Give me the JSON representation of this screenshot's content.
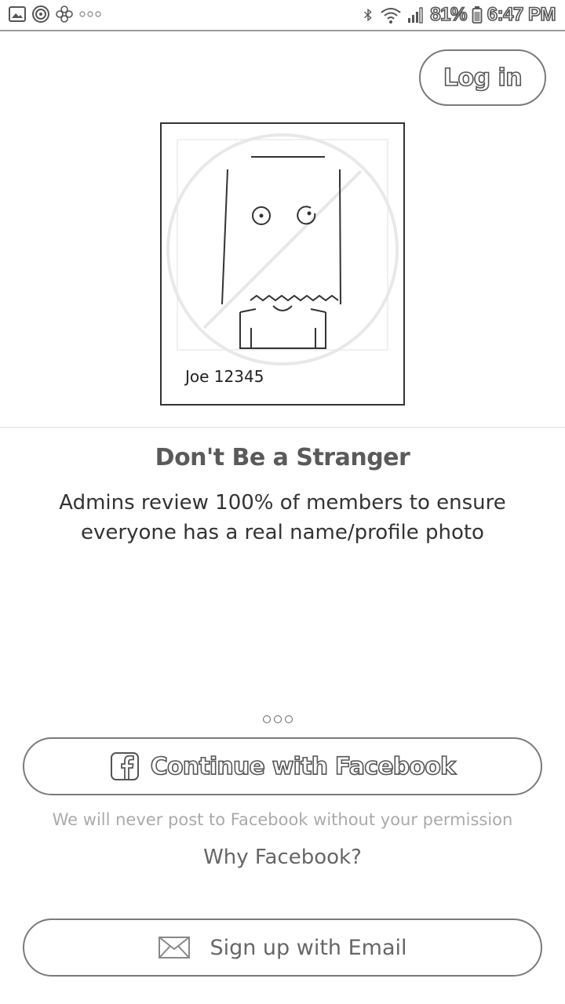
{
  "status_bar": {
    "battery": "81%",
    "time": "6:47 PM",
    "left_icons": [
      "photo-icon",
      "target-icon",
      "flower-icon",
      "more-dots-icon"
    ],
    "right_icons": [
      "bluetooth-icon",
      "wifi-icon",
      "signal-icon",
      "battery-icon"
    ]
  },
  "header": {
    "login_label": "Log in"
  },
  "illustration": {
    "card_name": "Joe 12345"
  },
  "content": {
    "headline": "Don't Be a Stranger",
    "subtext": "Admins review 100% of members to ensure everyone has a real name/profile photo"
  },
  "pager": {
    "count": 3
  },
  "facebook": {
    "button_label": "Continue with Facebook",
    "note": "We will never post to Facebook without your permission",
    "why_link": "Why Facebook?"
  },
  "email": {
    "button_label": "Sign up with Email"
  }
}
